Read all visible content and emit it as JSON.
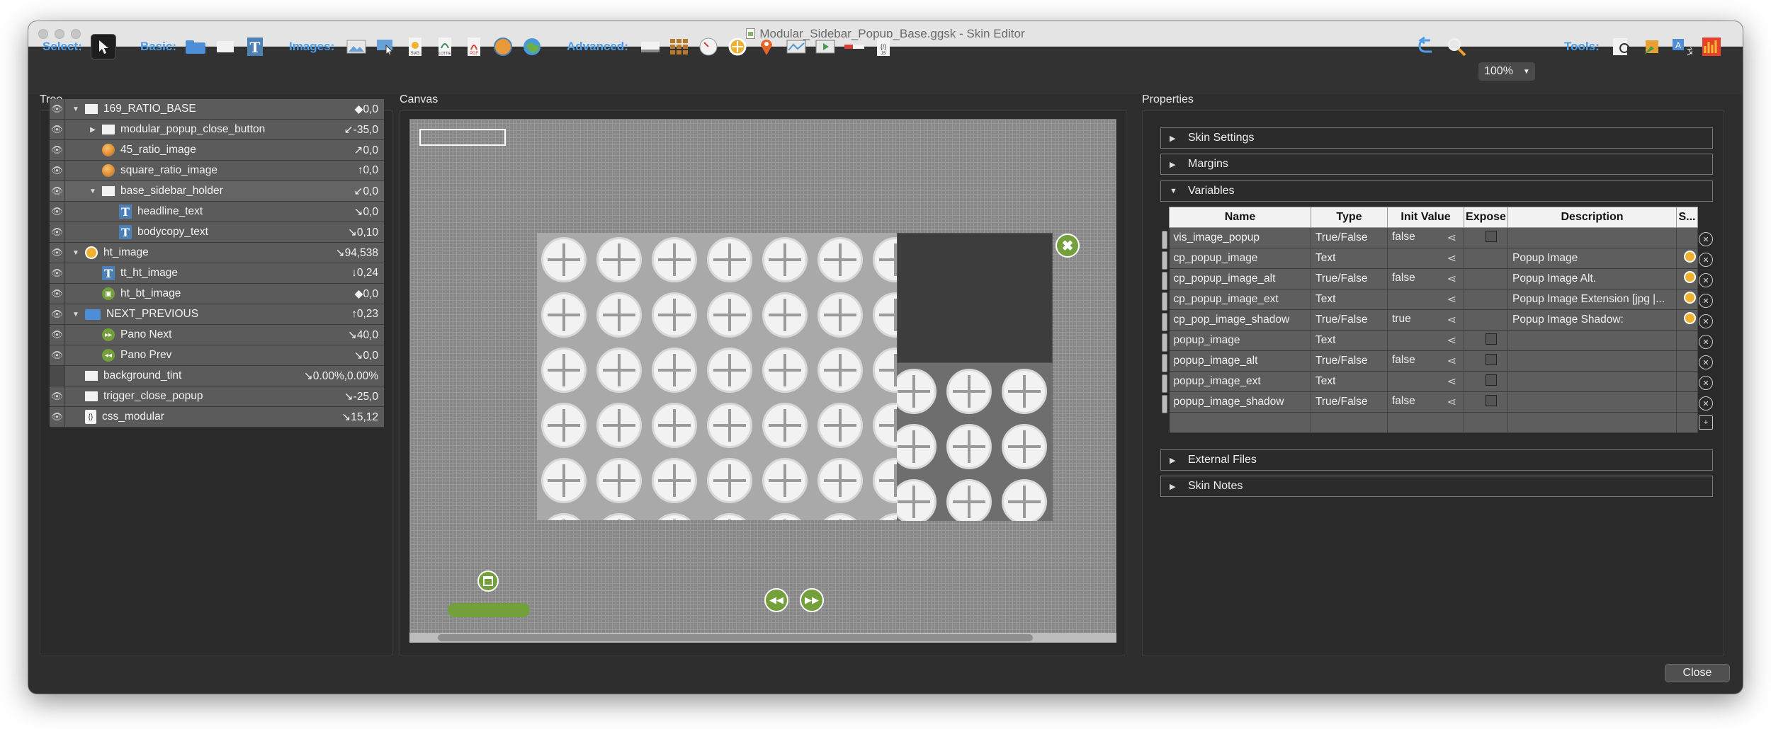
{
  "window": {
    "title": "Modular_Sidebar_Popup_Base.ggsk - Skin Editor"
  },
  "toolbar": {
    "select_label": "Select:",
    "basic_label": "Basic:",
    "images_label": "Images:",
    "advanced_label": "Advanced:",
    "tools_label": "Tools:",
    "zoom": "100%",
    "accent_color": "#4d9de8"
  },
  "panels": {
    "tree_title": "Tree",
    "canvas_title": "Canvas",
    "properties_title": "Properties"
  },
  "tree": [
    {
      "name": "169_RATIO_BASE",
      "value": "◆0,0",
      "icon": "rect-icon",
      "expand": "▼"
    },
    {
      "name": "modular_popup_close_button",
      "value": "↙-35,0",
      "icon": "rect-icon",
      "expand": "▶"
    },
    {
      "name": "45_ratio_image",
      "value": "↗0,0",
      "icon": "globe-icon",
      "expand": ""
    },
    {
      "name": "square_ratio_image",
      "value": "↑0,0",
      "icon": "globe-icon",
      "expand": ""
    },
    {
      "name": "base_sidebar_holder",
      "value": "↙0,0",
      "icon": "rect-icon",
      "expand": "▼"
    },
    {
      "name": "headline_text",
      "value": "↘0,0",
      "icon": "text-icon",
      "expand": ""
    },
    {
      "name": "bodycopy_text",
      "value": "↘0,10",
      "icon": "text-icon",
      "expand": ""
    },
    {
      "name": "ht_image",
      "value": "↘94,538",
      "icon": "hotspot-icon",
      "expand": "▼"
    },
    {
      "name": "tt_ht_image",
      "value": "↓0,24",
      "icon": "text-icon",
      "expand": ""
    },
    {
      "name": "ht_bt_image",
      "value": "◆0,0",
      "icon": "image-button-icon",
      "expand": ""
    },
    {
      "name": "NEXT_PREVIOUS",
      "value": "↑0,23",
      "icon": "folder-icon",
      "expand": "▼"
    },
    {
      "name": "Pano Next",
      "value": "↘40,0",
      "icon": "next-button-icon",
      "expand": ""
    },
    {
      "name": "Pano Prev",
      "value": "↘0,0",
      "icon": "prev-button-icon",
      "expand": ""
    },
    {
      "name": "background_tint",
      "value": "↘0.00%,0.00%",
      "icon": "rect-icon",
      "expand": ""
    },
    {
      "name": "trigger_close_popup",
      "value": "↘-25,0",
      "icon": "rect-icon",
      "expand": ""
    },
    {
      "name": "css_modular",
      "value": "↘15,12",
      "icon": "css-icon",
      "expand": ""
    }
  ],
  "properties": {
    "sections": {
      "skin_settings": "Skin Settings",
      "margins": "Margins",
      "variables": "Variables",
      "external_files": "External Files",
      "skin_notes": "Skin Notes"
    },
    "columns": [
      "Name",
      "Type",
      "Init Value",
      "Expose",
      "Description",
      "S..."
    ],
    "variables": [
      {
        "name": "vis_image_popup",
        "type": "True/False",
        "init": "false",
        "description": ""
      },
      {
        "name": "cp_popup_image",
        "type": "Text",
        "init": "",
        "description": "Popup Image"
      },
      {
        "name": "cp_popup_image_alt",
        "type": "True/False",
        "init": "false",
        "description": "Popup Image Alt."
      },
      {
        "name": "cp_popup_image_ext",
        "type": "Text",
        "init": "",
        "description": "Popup Image Extension [jpg |..."
      },
      {
        "name": "cp_pop_image_shadow",
        "type": "True/False",
        "init": "true",
        "description": "Popup Image Shadow:"
      },
      {
        "name": "popup_image",
        "type": "Text",
        "init": "",
        "description": ""
      },
      {
        "name": "popup_image_alt",
        "type": "True/False",
        "init": "false",
        "description": ""
      },
      {
        "name": "popup_image_ext",
        "type": "Text",
        "init": "",
        "description": ""
      },
      {
        "name": "popup_image_shadow",
        "type": "True/False",
        "init": "false",
        "description": ""
      }
    ]
  },
  "footer": {
    "close_label": "Close"
  }
}
